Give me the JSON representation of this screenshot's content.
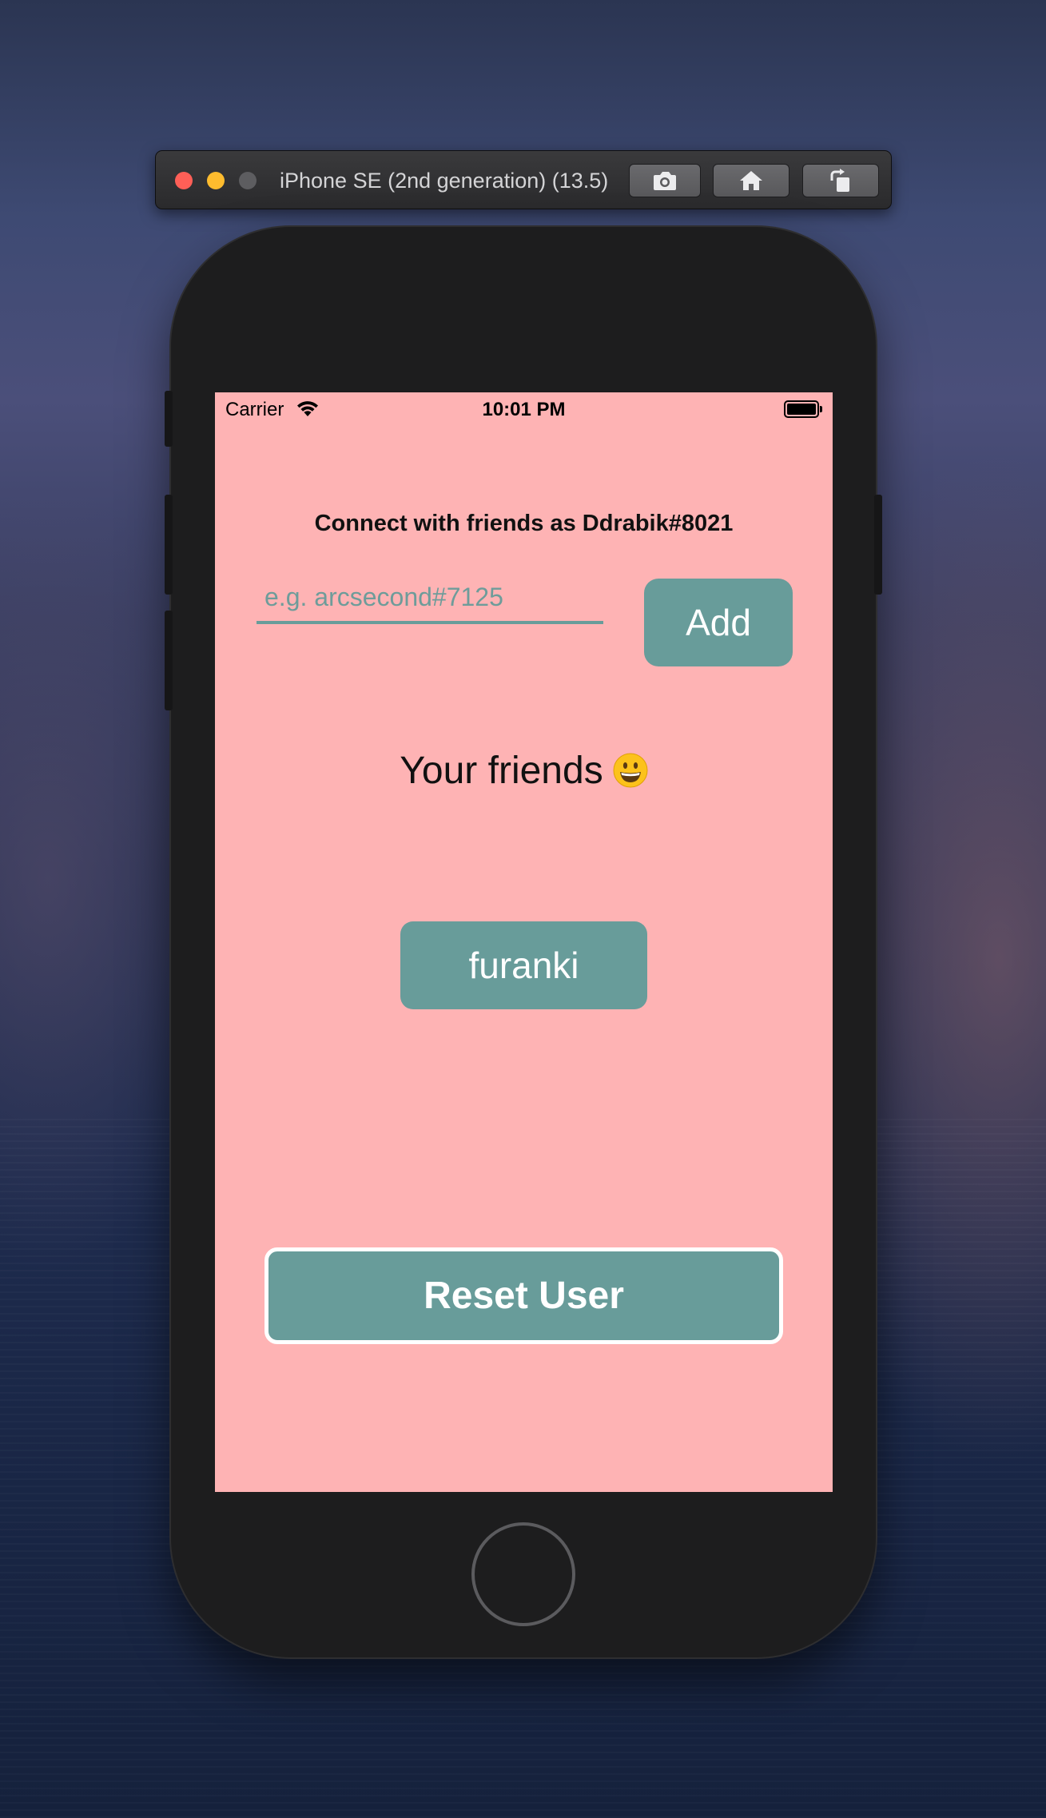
{
  "simulator": {
    "title": "iPhone SE (2nd generation) (13.5)",
    "buttons": [
      {
        "name": "screenshot",
        "icon": "camera-icon"
      },
      {
        "name": "home",
        "icon": "home-icon"
      },
      {
        "name": "rotate",
        "icon": "rotate-icon"
      }
    ]
  },
  "status_bar": {
    "carrier": "Carrier",
    "time": "10:01 PM"
  },
  "app": {
    "connect_text": "Connect with friends as Ddrabik#8021",
    "input_placeholder": "e.g. arcsecond#7125",
    "input_value": "",
    "add_label": "Add",
    "friends_title": "Your friends",
    "friends_emoji": "grinning-face-icon",
    "friends": [
      "furanki"
    ],
    "reset_label": "Reset User"
  },
  "colors": {
    "screen_bg": "#feb3b4",
    "accent": "#689c9a",
    "text": "#111111"
  }
}
